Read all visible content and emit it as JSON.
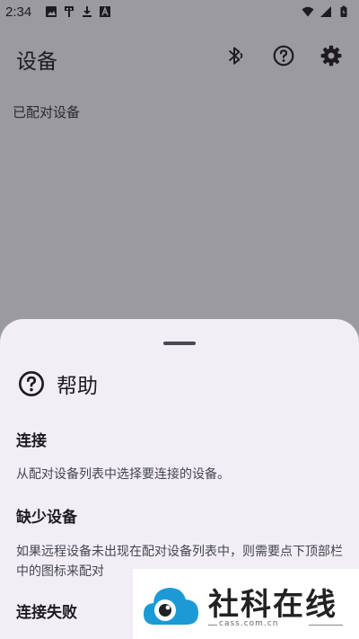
{
  "status_bar": {
    "time": "2:34",
    "icons_left": [
      "image-icon",
      "usb-icon",
      "download-icon",
      "text-a-icon"
    ],
    "icons_right": [
      "wifi-icon",
      "signal-icon",
      "battery-icon"
    ]
  },
  "app_bar": {
    "title": "设备",
    "actions": [
      "bluetooth-icon",
      "help-icon",
      "settings-icon"
    ]
  },
  "paired_devices": {
    "label": "已配对设备"
  },
  "help_sheet": {
    "title": "帮助",
    "sections": [
      {
        "title": "连接",
        "body": "从配对设备列表中选择要连接的设备。"
      },
      {
        "title": "缺少设备",
        "body": "如果远程设备未出现在配对设备列表中，则需要点下顶部栏中的图标来配对"
      },
      {
        "title": "连接失败",
        "body": ""
      }
    ]
  },
  "watermark": {
    "text": "社科在线",
    "url": "cass.com.cn"
  },
  "colors": {
    "scrim": "#9b9aa1",
    "sheet": "#f1eef6",
    "text": "#1d1b20",
    "watermark_blue": "#1b9ad6"
  }
}
